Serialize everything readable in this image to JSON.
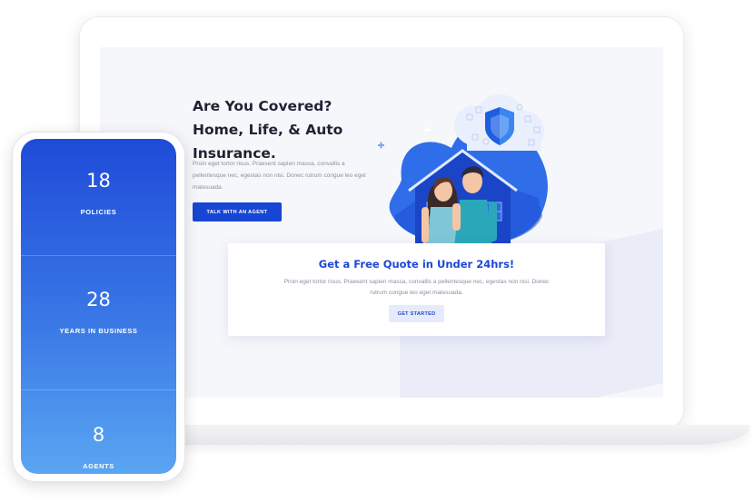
{
  "hero": {
    "title_lines": [
      "Are You Covered?",
      "Home, Life, & Auto",
      "Insurance."
    ],
    "description": "Proin eget tortor risus. Praesent sapien massa, convallis a pellentesque nec, egestas non nisi. Donec rutrum congue leo eget malesuada.",
    "cta_label": "TALK WITH AN AGENT"
  },
  "quote": {
    "title": "Get a Free Quote in Under 24hrs!",
    "description": "Proin eget tortor risus. Praesent sapien massa, convallis a pellentesque nec, egestas non nisi. Donec rutrum congue leo eget malesuada.",
    "cta_label": "GET STARTED"
  },
  "stats": [
    {
      "number": "18",
      "label": "POLICIES"
    },
    {
      "number": "28",
      "label": "YEARS IN BUSINESS"
    },
    {
      "number": "8",
      "label": "AGENTS"
    }
  ],
  "illustration": {
    "icons": [
      "shield-icon",
      "house-icon",
      "couple-icon"
    ]
  },
  "colors": {
    "accent": "#1846d4",
    "title": "#1f2233",
    "muted_text": "#8a8fa3",
    "phone_gradient_top": "#1e4bd8",
    "phone_gradient_bottom": "#5aa6f2"
  }
}
